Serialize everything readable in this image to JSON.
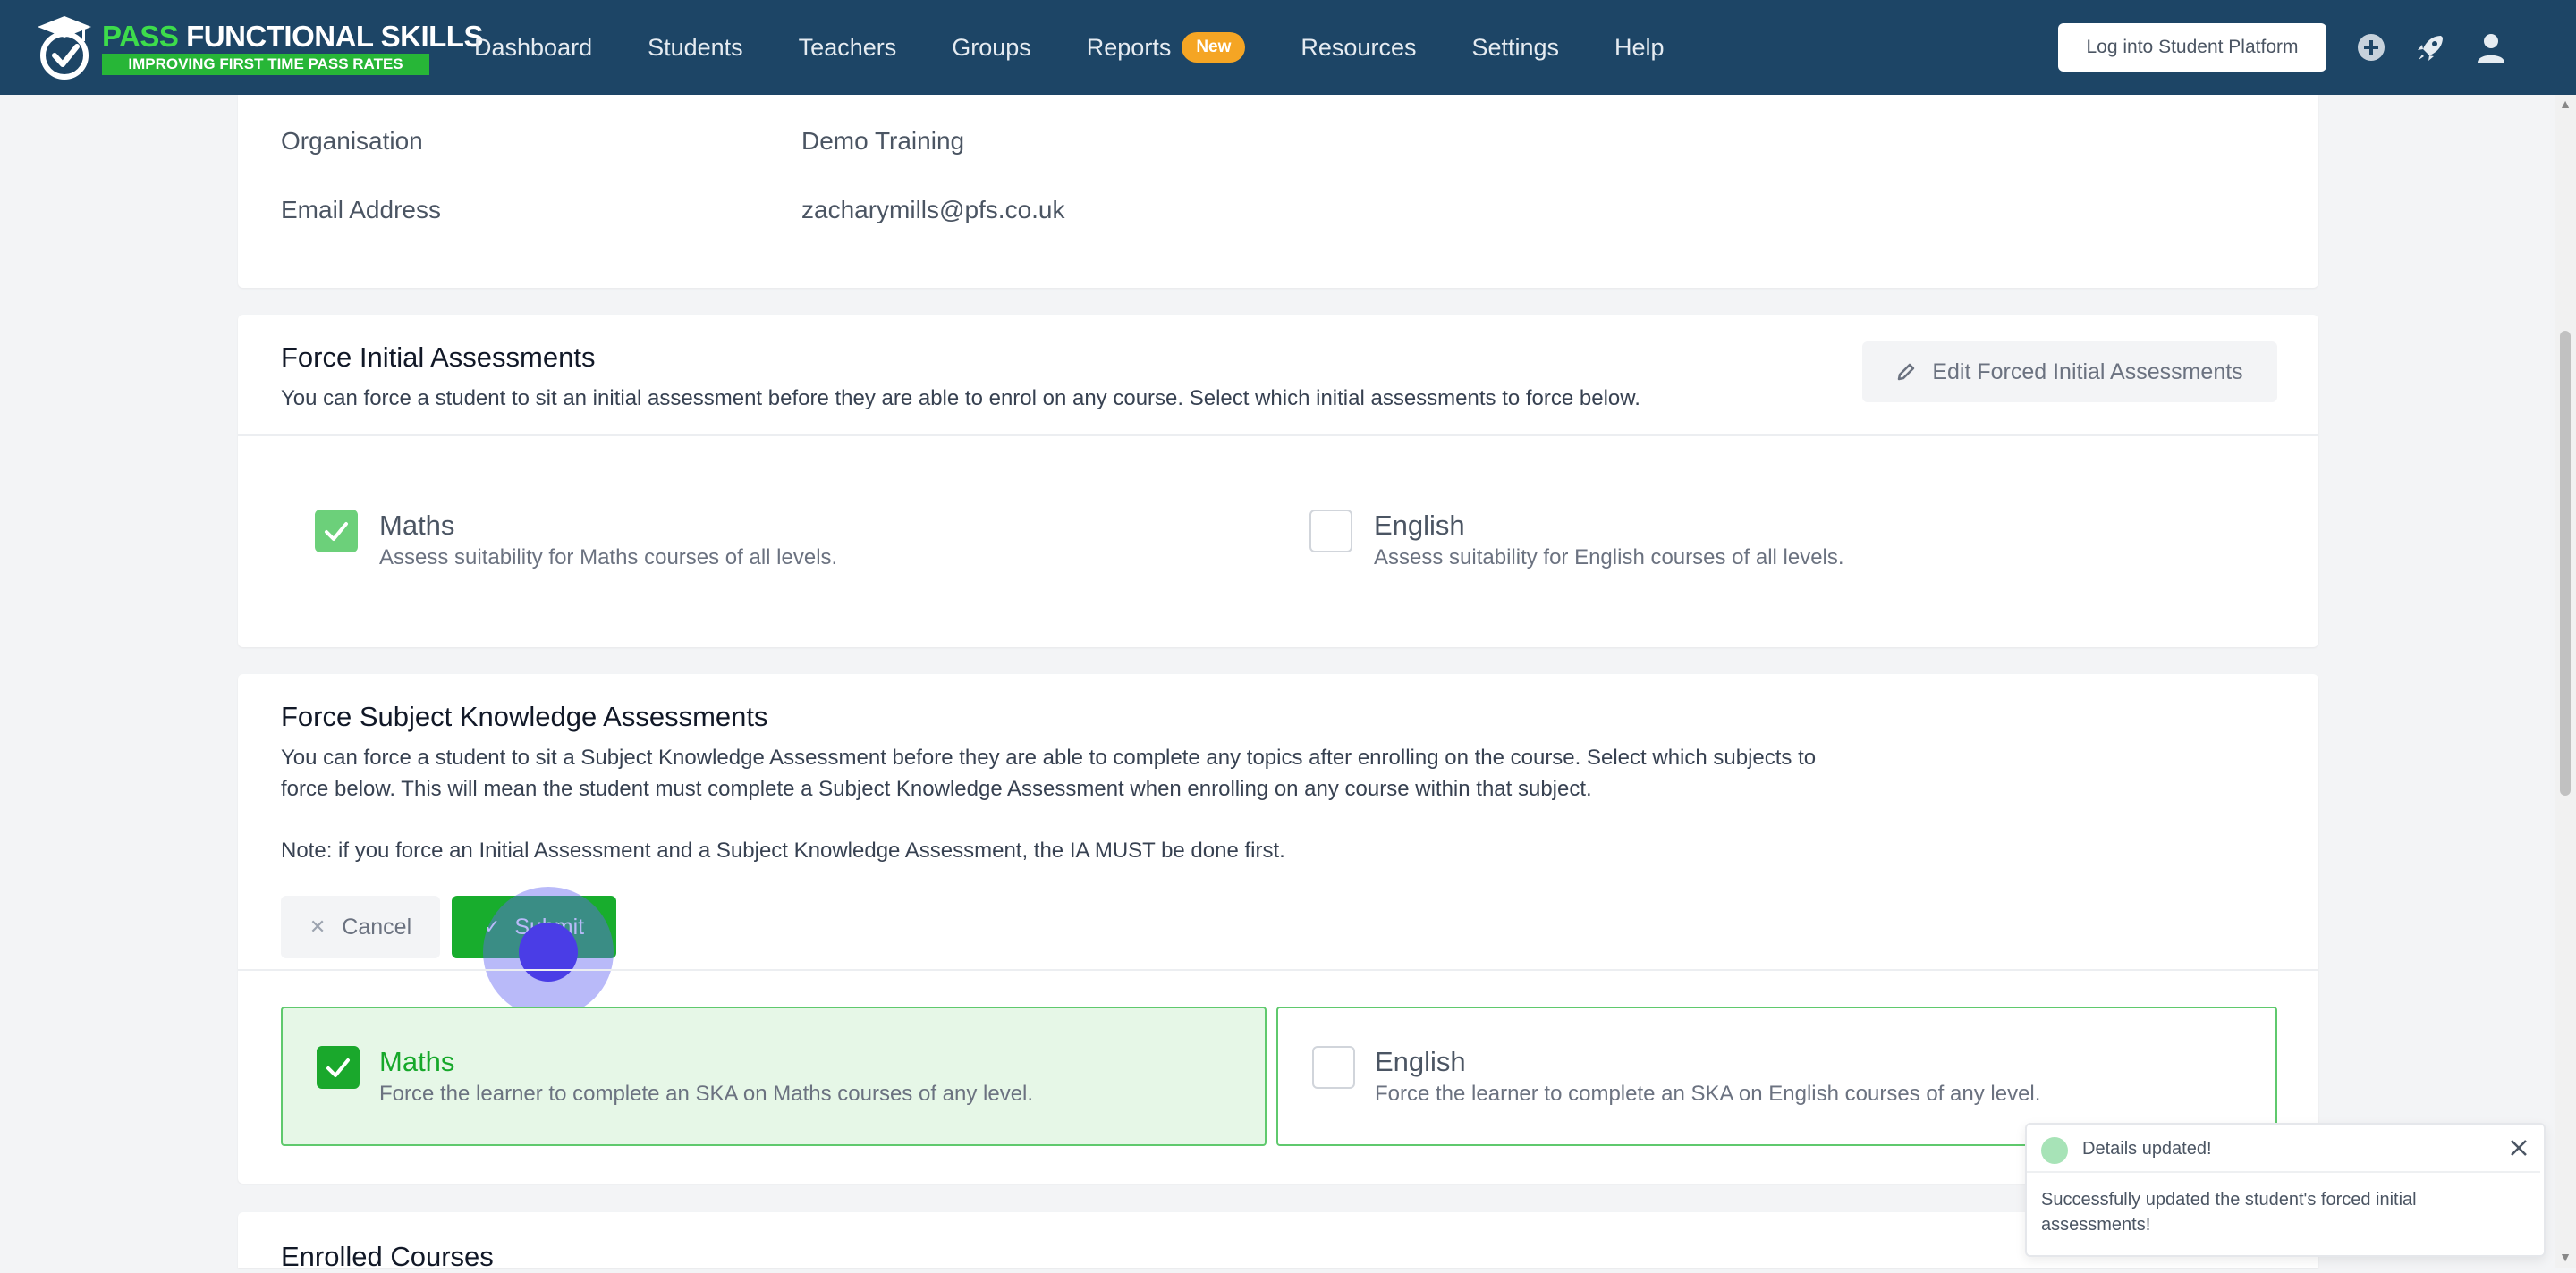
{
  "brand": {
    "title_part1": "PASS",
    "title_part2": "FUNCTIONAL SKILLS",
    "tagline": "IMPROVING FIRST TIME PASS RATES"
  },
  "nav": {
    "items": [
      "Dashboard",
      "Students",
      "Teachers",
      "Groups",
      "Reports",
      "Resources",
      "Settings",
      "Help"
    ],
    "reports_badge": "New",
    "login_button": "Log into Student Platform",
    "icons": [
      "plus-circle-icon",
      "rocket-icon",
      "user-icon"
    ]
  },
  "details": {
    "rows": [
      {
        "label": "Organisation",
        "value": "Demo Training"
      },
      {
        "label": "Email Address",
        "value": "zacharymills@pfs.co.uk"
      }
    ]
  },
  "force_initial": {
    "title": "Force Initial Assessments",
    "description": "You can force a student to sit an initial assessment before they are able to enrol on any course. Select which initial assessments to force below.",
    "edit_button": "Edit Forced Initial Assessments",
    "options": [
      {
        "title": "Maths",
        "description": "Assess suitability for Maths courses of all levels.",
        "checked": true
      },
      {
        "title": "English",
        "description": "Assess suitability for English courses of all levels.",
        "checked": false
      }
    ]
  },
  "force_ska": {
    "title": "Force Subject Knowledge Assessments",
    "description_line1": "You can force a student to sit a Subject Knowledge Assessment before they are able to complete any topics after enrolling on the course. Select which subjects to",
    "description_line2": "force below. This will mean the student must complete a Subject Knowledge Assessment when enrolling on any course within that subject.",
    "note": "Note: if you force an Initial Assessment and a Subject Knowledge Assessment, the IA MUST be done first.",
    "cancel_button": "Cancel",
    "submit_button": "Submit",
    "options": [
      {
        "title": "Maths",
        "description": "Force the learner to complete an SKA on Maths courses of any level.",
        "checked": true
      },
      {
        "title": "English",
        "description": "Force the learner to complete an SKA on English courses of any level.",
        "checked": false
      }
    ]
  },
  "enrolled": {
    "title": "Enrolled Courses"
  },
  "toast": {
    "title": "Details updated!",
    "message": "Successfully updated the student's forced initial assessments!"
  },
  "colors": {
    "navbar": "#1d4566",
    "brand_green": "#27b637",
    "submit_green": "#18ad2d",
    "badge_orange": "#f5a524"
  }
}
